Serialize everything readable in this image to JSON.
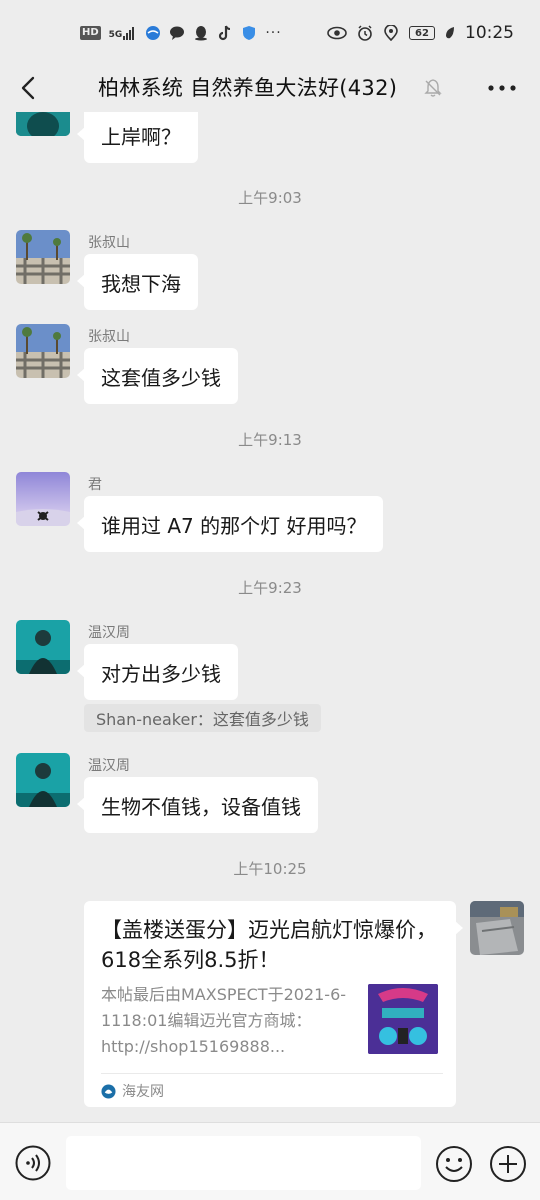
{
  "status_bar": {
    "network_badge": "HD",
    "signal_label": "5G",
    "battery_level": "62",
    "time": "10:25"
  },
  "header": {
    "title": "柏林系统 自然养鱼大法好(432)"
  },
  "messages": [
    {
      "type": "text",
      "text": "上岸啊？"
    },
    {
      "type": "time",
      "text": "上午9:03"
    },
    {
      "type": "text",
      "sender": "张叔山",
      "text": "我想下海"
    },
    {
      "type": "text",
      "sender": "张叔山",
      "text": "这套值多少钱"
    },
    {
      "type": "time",
      "text": "上午9:13"
    },
    {
      "type": "text",
      "sender": "君",
      "text": "谁用过 A7 的那个灯  好用吗？"
    },
    {
      "type": "time",
      "text": "上午9:23"
    },
    {
      "type": "text",
      "sender": "温汉周",
      "text": "对方出多少钱",
      "quote": "Shan-neaker：这套值多少钱"
    },
    {
      "type": "text",
      "sender": "温汉周",
      "text": "生物不值钱，设备值钱"
    },
    {
      "type": "time",
      "text": "上午10:25"
    }
  ],
  "link_card": {
    "title": "【盖楼送蛋分】迈光启航灯惊爆价，618全系列8.5折！",
    "description": "本帖最后由MAXSPECT于2021-6-1118:01编辑迈光官方商城：http://shop15169888...",
    "source": "海友网"
  },
  "input_bar": {
    "text_value": ""
  },
  "colors": {
    "background": "#ededed",
    "bubble": "#ffffff",
    "timestamp": "#8a8a8a",
    "thumb_purple": "#5b3fa8"
  }
}
